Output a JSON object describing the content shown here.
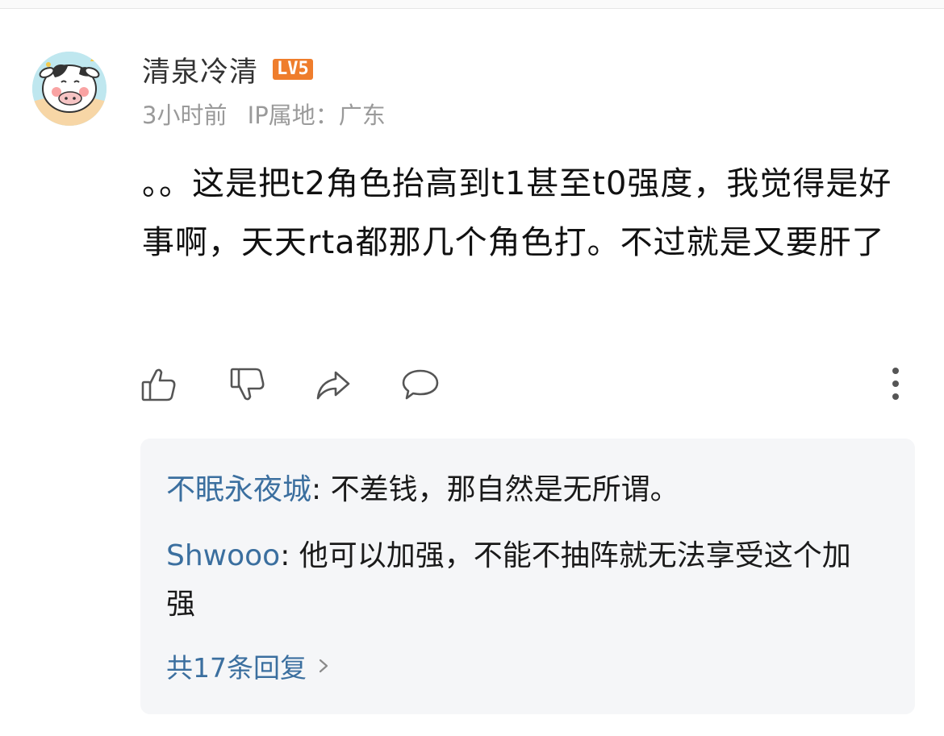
{
  "comment": {
    "author": "清泉冷清",
    "level_badge": "LV5",
    "time": "3小时前",
    "ip_location": "IP属地：广东",
    "text": "。。这是把t2角色抬高到t1甚至t0强度，我觉得是好事啊，天天rta都那几个角色打。不过就是又要肝了"
  },
  "actions": {
    "like_icon": "thumbs-up-icon",
    "dislike_icon": "thumbs-down-icon",
    "share_icon": "share-arrow-icon",
    "reply_icon": "speech-bubble-icon",
    "more_icon": "vertical-ellipsis-icon"
  },
  "replies": [
    {
      "author": "不眠永夜城",
      "sep": ": ",
      "text": "不差钱，那自然是无所谓。"
    },
    {
      "author": "Shwooo",
      "sep": ": ",
      "text": "他可以加强，不能不抽阵就无法享受这个加强"
    }
  ],
  "more_replies_label": "共17条回复",
  "colors": {
    "link_blue": "#3b6f9f",
    "badge_orange": "#ef7d2c",
    "meta_gray": "#9a9a9a",
    "reply_bg": "#f5f6f8"
  }
}
